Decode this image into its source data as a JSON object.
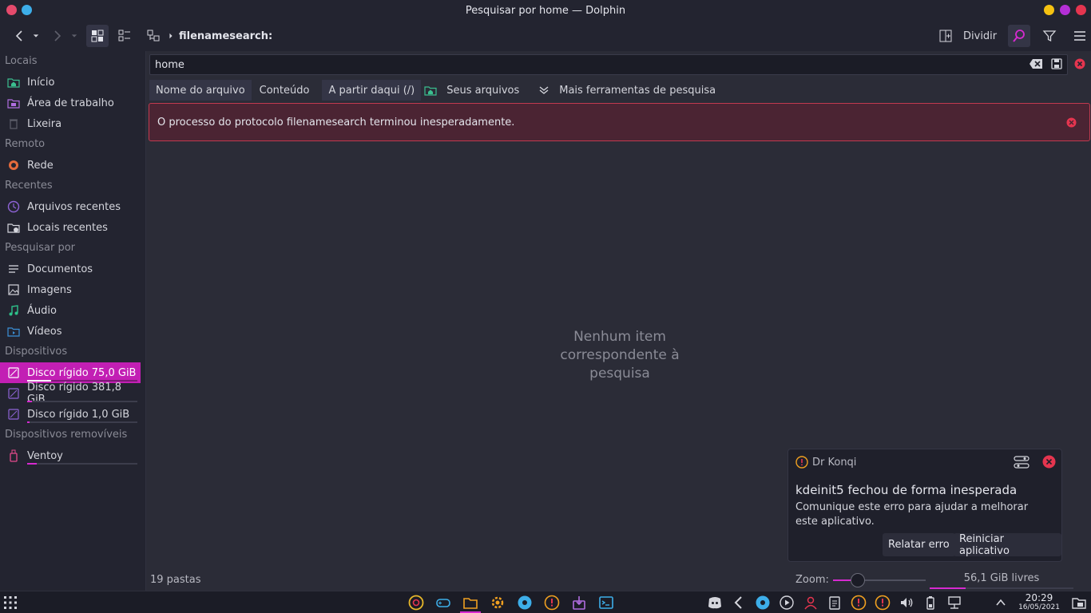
{
  "window": {
    "title": "Pesquisar por home — Dolphin"
  },
  "toolbar": {
    "breadcrumb": "filenamesearch:",
    "split_label": "Dividir"
  },
  "sidebar": {
    "sections": [
      {
        "title": "Locais",
        "items": [
          {
            "label": "Início",
            "icon": "home-folder-icon"
          },
          {
            "label": "Área de trabalho",
            "icon": "desktop-folder-icon"
          },
          {
            "label": "Lixeira",
            "icon": "trash-icon"
          }
        ]
      },
      {
        "title": "Remoto",
        "items": [
          {
            "label": "Rede",
            "icon": "network-icon"
          }
        ]
      },
      {
        "title": "Recentes",
        "items": [
          {
            "label": "Arquivos recentes",
            "icon": "recent-files-icon"
          },
          {
            "label": "Locais recentes",
            "icon": "recent-locations-icon"
          }
        ]
      },
      {
        "title": "Pesquisar por",
        "items": [
          {
            "label": "Documentos",
            "icon": "documents-icon"
          },
          {
            "label": "Imagens",
            "icon": "images-icon"
          },
          {
            "label": "Áudio",
            "icon": "audio-icon"
          },
          {
            "label": "Vídeos",
            "icon": "videos-icon"
          }
        ]
      },
      {
        "title": "Dispositivos",
        "items": [
          {
            "label": "Disco rígido 75,0 GiB",
            "icon": "hard-drive-icon",
            "usage": 0.22
          },
          {
            "label": "Disco rígido 381,8 GiB",
            "icon": "hard-drive-icon",
            "usage": 0.04
          },
          {
            "label": "Disco rígido 1,0 GiB",
            "icon": "hard-drive-icon",
            "usage": 0.02
          }
        ]
      },
      {
        "title": "Dispositivos removíveis",
        "items": [
          {
            "label": "Ventoy",
            "icon": "usb-drive-icon",
            "usage": 0.09
          }
        ]
      }
    ]
  },
  "search": {
    "value": "home",
    "filters": [
      "Nome do arquivo",
      "Conteúdo",
      "A partir daqui (/)",
      "Seus arquivos",
      "Mais ferramentas de pesquisa"
    ]
  },
  "error": {
    "message": "O processo do protocolo filenamesearch terminou inesperadamente."
  },
  "main": {
    "empty_line1": "Nenhum item",
    "empty_line2": "correspondente à",
    "empty_line3": "pesquisa"
  },
  "status": {
    "folders": "19 pastas",
    "zoom_label": "Zoom:",
    "zoom_level": 0.27,
    "free_space": "56,1 GiB livres",
    "used_fraction": 0.25
  },
  "notification": {
    "app": "Dr Konqi",
    "title": "kdeinit5 fechou de forma inesperada",
    "body": "Comunique este erro para ajudar a melhorar este aplicativo.",
    "report_label": "Relatar erro",
    "restart_label": "Reiniciar aplicativo"
  },
  "clock": {
    "time": "20:29",
    "date": "16/05/2021"
  },
  "colors": {
    "accent": "#d62ad0",
    "selection": "#c21fb4",
    "error": "#c23a4f"
  }
}
